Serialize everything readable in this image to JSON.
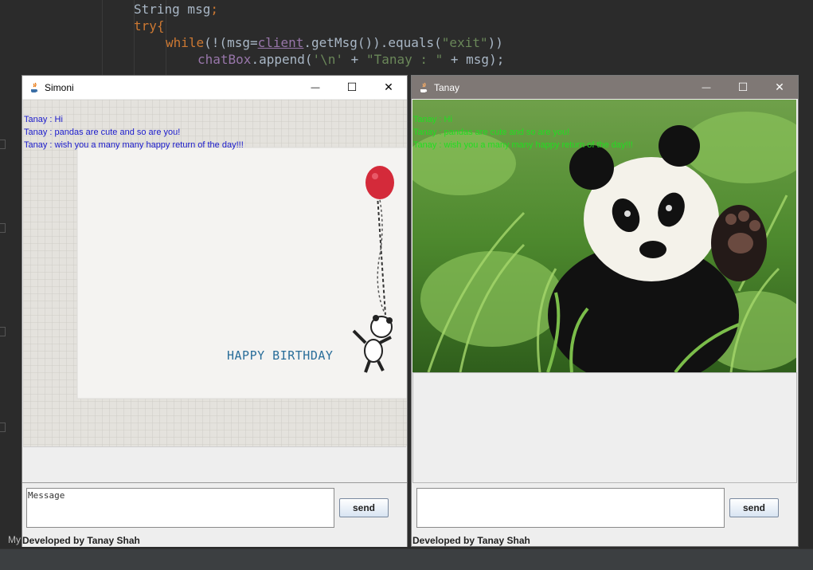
{
  "ide": {
    "code_line1_type": "String",
    "code_line1_var": " msg",
    "code_line1_end": ";",
    "code_line2": "try{",
    "code_line3_kw": "while",
    "code_line3_a": "(!(msg=",
    "code_line3_client": "client",
    "code_line3_b": ".getMsg()).equals(",
    "code_line3_str": "\"exit\"",
    "code_line3_c": "))",
    "code_line4_field": "chatBox",
    "code_line4_a": ".append(",
    "code_line4_str1": "'\\n'",
    "code_line4_b": " + ",
    "code_line4_str2": "\"Tanay : \"",
    "code_line4_c": " + msg);",
    "bottom_text": "My",
    "colors": {
      "background": "#2b2b2b",
      "keyword": "#cc7832",
      "string": "#6a8759",
      "field": "#9876aa"
    }
  },
  "windows": {
    "simoni": {
      "title": "Simoni",
      "messages": [
        "Tanay : Hi",
        "Tanay : pandas are cute and so are you!",
        "Tanay : wish you a many many happy return of the day!!!"
      ],
      "message_color": "#1a1acc",
      "card_text": "HAPPY BIRTHDAY",
      "input_value": "Message",
      "send_label": "send",
      "credit": "Developed by Tanay Shah"
    },
    "tanay": {
      "title": "Tanay",
      "messages": [
        "Tanay : Hi",
        "Tanay : pandas are cute and so are you!",
        "Tanay : wish you a many many happy return of the day!!!"
      ],
      "message_color": "#22dd22",
      "input_value": "",
      "send_label": "send",
      "credit": "Developed by Tanay Shah"
    }
  },
  "controls": {
    "minimize": "—",
    "maximize": "☐",
    "close": "✕"
  }
}
